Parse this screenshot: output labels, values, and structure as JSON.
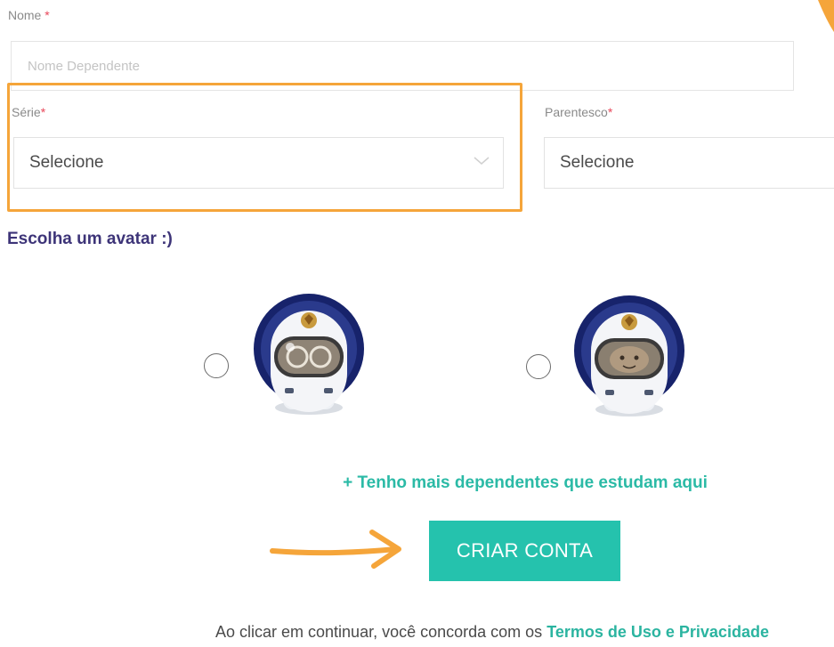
{
  "form": {
    "nome_label": "Nome",
    "required_mark": "*",
    "nome_placeholder": "Nome Dependente",
    "serie_label": "Série",
    "serie_value": "Selecione",
    "parentesco_label": "Parentesco",
    "parentesco_value": "Selecione"
  },
  "avatar_section": {
    "title": "Escolha um avatar :)"
  },
  "actions": {
    "more_dependents": "+ Tenho mais dependentes que estudam aqui",
    "create_account": "CRIAR CONTA"
  },
  "footer": {
    "text": "Ao clicar em continuar, você concorda com os",
    "terms_link": "Termos de Uso e Privacidade"
  },
  "colors": {
    "accent": "#25c2ad",
    "annotation": "#f5a53a",
    "heading": "#3d3478",
    "required": "#e8475a"
  },
  "icons": {
    "avatar_1": "astronaut-girl-icon",
    "avatar_2": "astronaut-boy-icon",
    "annotation_arrow": "arrow-right-icon",
    "select_chevron": "chevron-down-icon"
  }
}
